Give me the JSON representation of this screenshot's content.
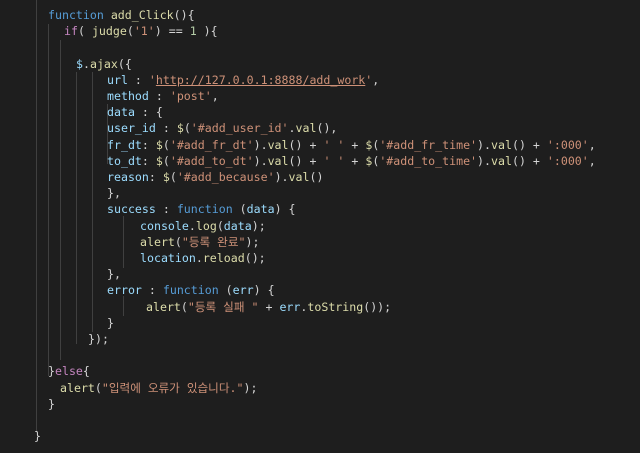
{
  "code": [
    {
      "indent": 48,
      "tokens": [
        [
          "kw",
          "function"
        ],
        [
          "pun",
          " "
        ],
        [
          "fn",
          "add_Click"
        ],
        [
          "pun",
          "(){"
        ]
      ]
    },
    {
      "indent": 64,
      "tokens": [
        [
          "ctl",
          "if"
        ],
        [
          "pun",
          "( "
        ],
        [
          "fn",
          "judge"
        ],
        [
          "pun",
          "("
        ],
        [
          "str",
          "'1'"
        ],
        [
          "pun",
          ") == "
        ],
        [
          "num",
          "1"
        ],
        [
          "pun",
          " ){"
        ]
      ]
    },
    {
      "indent": 0,
      "tokens": []
    },
    {
      "indent": 76,
      "tokens": [
        [
          "var",
          "$"
        ],
        [
          "pun",
          "."
        ],
        [
          "fn",
          "ajax"
        ],
        [
          "pun",
          "({"
        ]
      ]
    },
    {
      "indent": 107,
      "tokens": [
        [
          "var",
          "url"
        ],
        [
          "pun",
          " : "
        ],
        [
          "str",
          "'"
        ],
        [
          "url",
          "http://127.0.0.1:8888/add_work"
        ],
        [
          "str",
          "'"
        ],
        [
          "pun",
          ","
        ]
      ]
    },
    {
      "indent": 107,
      "tokens": [
        [
          "var",
          "method"
        ],
        [
          "pun",
          " : "
        ],
        [
          "str",
          "'post'"
        ],
        [
          "pun",
          ","
        ]
      ]
    },
    {
      "indent": 107,
      "tokens": [
        [
          "var",
          "data"
        ],
        [
          "pun",
          " : {"
        ]
      ]
    },
    {
      "indent": 107,
      "tokens": [
        [
          "var",
          "user_id"
        ],
        [
          "pun",
          " : "
        ],
        [
          "fn",
          "$"
        ],
        [
          "pun",
          "("
        ],
        [
          "str",
          "'#add_user_id'"
        ],
        [
          "pun",
          "."
        ],
        [
          "fn",
          "val"
        ],
        [
          "pun",
          "(),"
        ]
      ]
    },
    {
      "indent": 107,
      "tokens": [
        [
          "var",
          "fr_dt"
        ],
        [
          "pun",
          ": "
        ],
        [
          "fn",
          "$"
        ],
        [
          "pun",
          "("
        ],
        [
          "str",
          "'#add_fr_dt'"
        ],
        [
          "pun",
          ")."
        ],
        [
          "fn",
          "val"
        ],
        [
          "pun",
          "() + "
        ],
        [
          "str",
          "' '"
        ],
        [
          "pun",
          " + "
        ],
        [
          "fn",
          "$"
        ],
        [
          "pun",
          "("
        ],
        [
          "str",
          "'#add_fr_time'"
        ],
        [
          "pun",
          ")."
        ],
        [
          "fn",
          "val"
        ],
        [
          "pun",
          "() + "
        ],
        [
          "str",
          "':000'"
        ],
        [
          "pun",
          ","
        ]
      ]
    },
    {
      "indent": 107,
      "tokens": [
        [
          "var",
          "to_dt"
        ],
        [
          "pun",
          ": "
        ],
        [
          "fn",
          "$"
        ],
        [
          "pun",
          "("
        ],
        [
          "str",
          "'#add_to_dt'"
        ],
        [
          "pun",
          ")."
        ],
        [
          "fn",
          "val"
        ],
        [
          "pun",
          "() + "
        ],
        [
          "str",
          "' '"
        ],
        [
          "pun",
          " + "
        ],
        [
          "fn",
          "$"
        ],
        [
          "pun",
          "("
        ],
        [
          "str",
          "'#add_to_time'"
        ],
        [
          "pun",
          ")."
        ],
        [
          "fn",
          "val"
        ],
        [
          "pun",
          "() + "
        ],
        [
          "str",
          "':000'"
        ],
        [
          "pun",
          ","
        ]
      ]
    },
    {
      "indent": 107,
      "tokens": [
        [
          "var",
          "reason"
        ],
        [
          "pun",
          ": "
        ],
        [
          "fn",
          "$"
        ],
        [
          "pun",
          "("
        ],
        [
          "str",
          "'#add_because'"
        ],
        [
          "pun",
          ")."
        ],
        [
          "fn",
          "val"
        ],
        [
          "pun",
          "()"
        ]
      ]
    },
    {
      "indent": 107,
      "tokens": [
        [
          "pun",
          "},"
        ]
      ]
    },
    {
      "indent": 107,
      "tokens": [
        [
          "var",
          "success"
        ],
        [
          "pun",
          " : "
        ],
        [
          "kw",
          "function"
        ],
        [
          "pun",
          " ("
        ],
        [
          "var",
          "data"
        ],
        [
          "pun",
          ") {"
        ]
      ]
    },
    {
      "indent": 140,
      "tokens": [
        [
          "var",
          "console"
        ],
        [
          "pun",
          "."
        ],
        [
          "fn",
          "log"
        ],
        [
          "pun",
          "("
        ],
        [
          "var",
          "data"
        ],
        [
          "pun",
          ");"
        ]
      ]
    },
    {
      "indent": 140,
      "tokens": [
        [
          "fn",
          "alert"
        ],
        [
          "pun",
          "("
        ],
        [
          "str",
          "\"등록 완료\""
        ],
        [
          "pun",
          ");"
        ]
      ]
    },
    {
      "indent": 140,
      "tokens": [
        [
          "var",
          "location"
        ],
        [
          "pun",
          "."
        ],
        [
          "fn",
          "reload"
        ],
        [
          "pun",
          "();"
        ]
      ]
    },
    {
      "indent": 107,
      "tokens": [
        [
          "pun",
          "},"
        ]
      ]
    },
    {
      "indent": 107,
      "tokens": [
        [
          "var",
          "error"
        ],
        [
          "pun",
          " : "
        ],
        [
          "kw",
          "function"
        ],
        [
          "pun",
          " ("
        ],
        [
          "var",
          "err"
        ],
        [
          "pun",
          ") {"
        ]
      ]
    },
    {
      "indent": 146,
      "tokens": [
        [
          "fn",
          "alert"
        ],
        [
          "pun",
          "("
        ],
        [
          "str",
          "\"등록 실패 \""
        ],
        [
          "pun",
          " + "
        ],
        [
          "var",
          "err"
        ],
        [
          "pun",
          "."
        ],
        [
          "fn",
          "toString"
        ],
        [
          "pun",
          "());"
        ]
      ]
    },
    {
      "indent": 107,
      "tokens": [
        [
          "pun",
          "}"
        ]
      ]
    },
    {
      "indent": 88,
      "tokens": [
        [
          "pun",
          "});"
        ]
      ]
    },
    {
      "indent": 0,
      "tokens": []
    },
    {
      "indent": 48,
      "tokens": [
        [
          "pun",
          "}"
        ],
        [
          "ctl",
          "else"
        ],
        [
          "pun",
          "{"
        ]
      ]
    },
    {
      "indent": 60,
      "tokens": [
        [
          "fn",
          "alert"
        ],
        [
          "pun",
          "("
        ],
        [
          "str",
          "\"입력에 오류가 있습니다.\""
        ],
        [
          "pun",
          ");"
        ]
      ]
    },
    {
      "indent": 48,
      "tokens": [
        [
          "pun",
          "}"
        ]
      ]
    },
    {
      "indent": 0,
      "tokens": []
    },
    {
      "indent": 34,
      "tokens": [
        [
          "pun",
          "}"
        ]
      ]
    }
  ]
}
